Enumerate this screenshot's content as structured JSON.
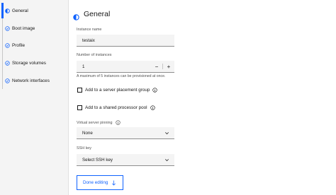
{
  "sidebar": {
    "items": [
      {
        "label": "General",
        "icon": "half-circle-icon",
        "state": "active"
      },
      {
        "label": "Boot image",
        "icon": "checkmark-circle-icon",
        "state": "complete"
      },
      {
        "label": "Profile",
        "icon": "checkmark-circle-icon",
        "state": "complete"
      },
      {
        "label": "Storage volumes",
        "icon": "checkmark-circle-icon",
        "state": "complete"
      },
      {
        "label": "Network interfaces",
        "icon": "checkmark-circle-icon",
        "state": "complete"
      }
    ]
  },
  "main": {
    "title": "General",
    "instance_name": {
      "label": "Instance name",
      "value": "testaix"
    },
    "number_of_instances": {
      "label": "Number of instances",
      "value": "1",
      "decrement": "−",
      "increment": "+",
      "helper": "A maximum of 5 instances can be provisioned at once."
    },
    "placement_group": {
      "label": "Add to a server placement group",
      "checked": false
    },
    "shared_pool": {
      "label": "Add to a shared processor pool",
      "checked": false
    },
    "server_pinning": {
      "label": "Virtual server pinning",
      "value": "None"
    },
    "ssh_key": {
      "label": "SSH key",
      "value": "Select SSH key"
    },
    "done_button": "Done editing"
  },
  "colors": {
    "accent": "#0f62fe",
    "field_bg": "#f4f4f4",
    "text": "#161616",
    "muted": "#525252"
  }
}
